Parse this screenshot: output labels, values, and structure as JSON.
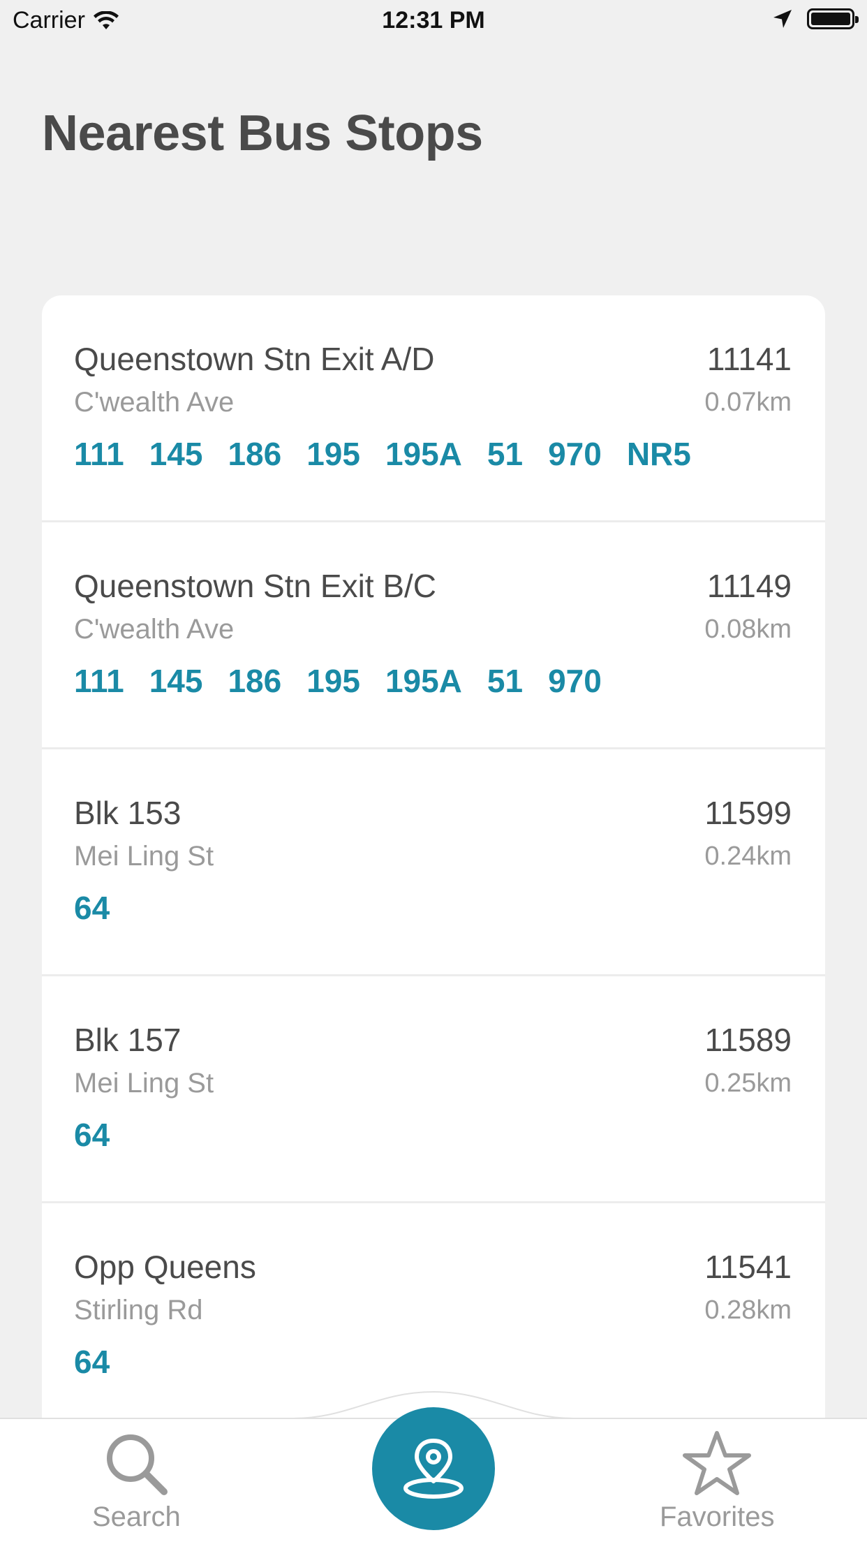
{
  "status_bar": {
    "carrier": "Carrier",
    "time": "12:31 PM"
  },
  "page_title": "Nearest Bus Stops",
  "stops": [
    {
      "name": "Queenstown Stn Exit A/D",
      "road": "C'wealth Ave",
      "code": "11141",
      "distance": "0.07km",
      "services": [
        "111",
        "145",
        "186",
        "195",
        "195A",
        "51",
        "970",
        "NR5"
      ]
    },
    {
      "name": "Queenstown Stn Exit B/C",
      "road": "C'wealth Ave",
      "code": "11149",
      "distance": "0.08km",
      "services": [
        "111",
        "145",
        "186",
        "195",
        "195A",
        "51",
        "970"
      ]
    },
    {
      "name": "Blk 153",
      "road": "Mei Ling St",
      "code": "11599",
      "distance": "0.24km",
      "services": [
        "64"
      ]
    },
    {
      "name": "Blk 157",
      "road": "Mei Ling St",
      "code": "11589",
      "distance": "0.25km",
      "services": [
        "64"
      ]
    },
    {
      "name": "Opp Queens",
      "road": "Stirling Rd",
      "code": "11541",
      "distance": "0.28km",
      "services": [
        "64"
      ]
    }
  ],
  "tab_bar": {
    "search_label": "Search",
    "favorites_label": "Favorites",
    "center_icon": "location-pin-icon"
  },
  "colors": {
    "accent": "#1a8aa6",
    "background": "#f0f0f0",
    "title_text": "#4a4a4a",
    "secondary_text": "#9a9a9a"
  }
}
